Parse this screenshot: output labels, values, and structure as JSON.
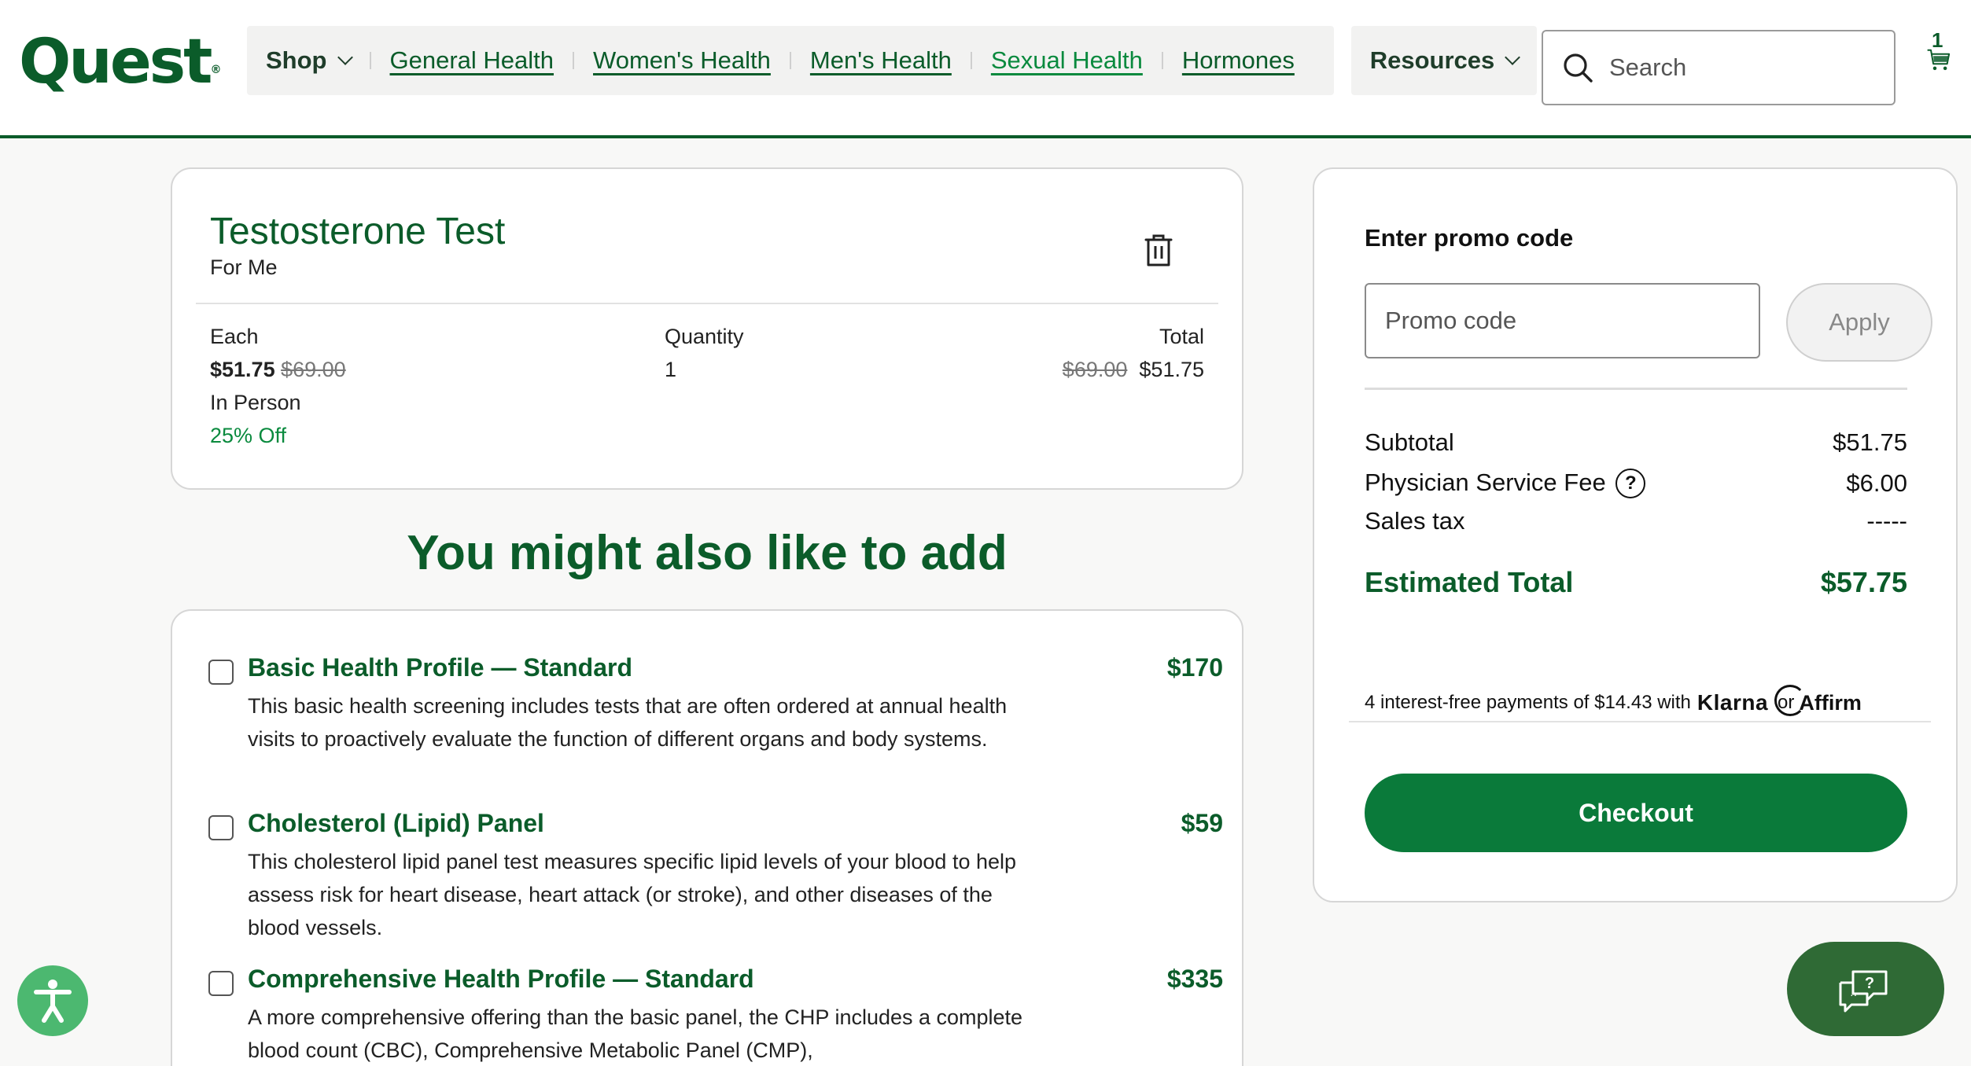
{
  "header": {
    "logo": "Quest",
    "logo_mark": "®",
    "nav": {
      "shop": "Shop",
      "general_health": "General Health",
      "womens_health": "Women's Health",
      "mens_health": "Men's Health",
      "sexual_health": "Sexual Health",
      "hormones": "Hormones",
      "resources": "Resources"
    },
    "search_placeholder": "Search",
    "cart_count": "1"
  },
  "cart_item": {
    "title": "Testosterone Test",
    "for": "For Me",
    "each_label": "Each",
    "each_price": "$51.75",
    "each_original": "$69.00",
    "mode": "In Person",
    "discount": "25% Off",
    "quantity_label": "Quantity",
    "quantity": "1",
    "total_label": "Total",
    "total_original": "$69.00",
    "total_price": "$51.75"
  },
  "recommendations": {
    "heading": "You might also like to add",
    "items": [
      {
        "name": "Basic Health Profile — Standard",
        "price": "$170",
        "description": "This basic health screening includes tests that are often ordered at annual health visits to proactively evaluate the function of different organs and body systems."
      },
      {
        "name": "Cholesterol (Lipid) Panel",
        "price": "$59",
        "description": "This cholesterol lipid panel test measures specific lipid levels of your blood to help assess risk for heart disease, heart attack (or stroke), and other diseases of the blood vessels."
      },
      {
        "name": "Comprehensive Health Profile — Standard",
        "price": "$335",
        "description": "A more comprehensive offering than the basic panel, the CHP includes a complete blood count (CBC), Comprehensive Metabolic Panel (CMP),"
      }
    ]
  },
  "summary": {
    "promo_label": "Enter promo code",
    "promo_placeholder": "Promo code",
    "apply": "Apply",
    "subtotal_label": "Subtotal",
    "subtotal": "$51.75",
    "fee_label": "Physician Service Fee",
    "fee": "$6.00",
    "tax_label": "Sales tax",
    "tax": "-----",
    "total_label": "Estimated Total",
    "total": "$57.75",
    "payments_note": "4 interest-free payments of $14.43 with",
    "klarna": "Klarna",
    "or": "or",
    "affirm": "Affirm",
    "checkout": "Checkout"
  },
  "colors": {
    "brand_green": "#0b5c2a",
    "link_green": "#0a8a3e",
    "checkout_green": "#0a7a3a",
    "chat_green": "#2f6a35",
    "accessibility_green": "#4cb870"
  },
  "icons": [
    "search-icon",
    "cart-icon",
    "trash-icon",
    "help-icon",
    "accessibility-icon",
    "chat-icon",
    "chevron-down-icon"
  ]
}
